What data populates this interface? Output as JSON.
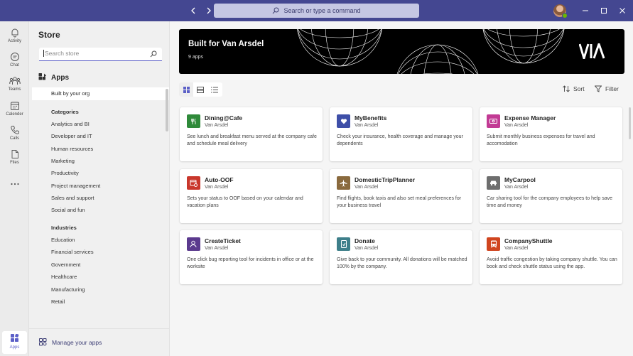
{
  "titlebar": {
    "search_placeholder": "Search or type a command"
  },
  "rail": {
    "items": [
      {
        "label": "Activity",
        "icon": "bell-icon"
      },
      {
        "label": "Chat",
        "icon": "chat-icon"
      },
      {
        "label": "Teams",
        "icon": "teams-icon"
      },
      {
        "label": "Calender",
        "icon": "calendar-icon"
      },
      {
        "label": "Calls",
        "icon": "phone-icon"
      },
      {
        "label": "Files",
        "icon": "file-icon"
      }
    ],
    "more": "more-icon",
    "apps_label": "Apps"
  },
  "panel": {
    "title": "Store",
    "search_placeholder": "Search store",
    "apps_header": "Apps",
    "built_by_org": "Built by your org",
    "categories_title": "Categories",
    "categories": [
      "Analytics and BI",
      "Developer and IT",
      "Human resources",
      "Marketing",
      "Productivity",
      "Project management",
      "Sales and support",
      "Social and fun"
    ],
    "industries_title": "Industries",
    "industries": [
      "Education",
      "Financial services",
      "Government",
      "Healthcare",
      "Manufacturing",
      "Retail"
    ],
    "manage": "Manage your apps"
  },
  "hero": {
    "title": "Built for Van Arsdel",
    "subtitle": "9 apps"
  },
  "toolbar": {
    "sort": "Sort",
    "filter": "Filter"
  },
  "colors": {
    "brand": "#444791",
    "accent": "#5b5fc7"
  },
  "apps": [
    {
      "name": "Dining@Cafe",
      "publisher": "Van Arsdel",
      "desc": "See lunch and breakfast menu served at the company cafe and schedule meal delivery",
      "color": "#2f8a3a",
      "icon": "fork-knife-icon"
    },
    {
      "name": "MyBenefits",
      "publisher": "Van Arsdel",
      "desc": "Check your insurance, health coverage and manage your dependents",
      "color": "#3e4fa8",
      "icon": "heart-icon"
    },
    {
      "name": "Expense Manager",
      "publisher": "Van Arsdel",
      "desc": "Submit monthly business expenses for travel and accomodation",
      "color": "#c23a94",
      "icon": "money-icon"
    },
    {
      "name": "Auto-OOF",
      "publisher": "Van Arsdel",
      "desc": "Sets your status to OOF based on your calendar and vacation plans",
      "color": "#c9372c",
      "icon": "calendar-away-icon"
    },
    {
      "name": "DomesticTripPlanner",
      "publisher": "Van Arsdel",
      "desc": "Find flights, book taxis and also set meal preferences for your business travel",
      "color": "#8a6a3e",
      "icon": "airplane-icon"
    },
    {
      "name": "MyCarpool",
      "publisher": "Van Arsdel",
      "desc": "Car sharing tool for the company employees to help save time and money",
      "color": "#6e6e6e",
      "icon": "car-icon"
    },
    {
      "name": "CreateTicket",
      "publisher": "Van Arsdel",
      "desc": "One click bug reporting tool for incidents in office or at the worksite",
      "color": "#5b3a8e",
      "icon": "person-ticket-icon"
    },
    {
      "name": "Donate",
      "publisher": "Van Arsdel",
      "desc": "Give back to your community. All donations will be matched 100% by the company.",
      "color": "#3e7f8a",
      "icon": "donate-icon"
    },
    {
      "name": "CompanyShuttle",
      "publisher": "Van Arsdel",
      "desc": "Avoid traffic congestion by taking company shuttle. You can book and check shuttle status using the app.",
      "color": "#d0451f",
      "icon": "bus-icon"
    }
  ]
}
